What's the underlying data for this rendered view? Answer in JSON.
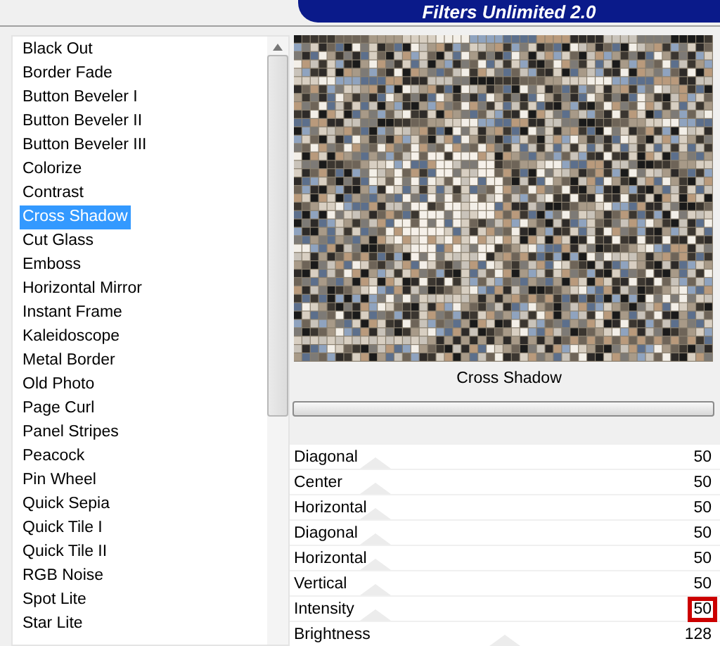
{
  "banner": {
    "title": "Filters Unlimited 2.0"
  },
  "filters": [
    {
      "label": "Black Out",
      "selected": false
    },
    {
      "label": "Border Fade",
      "selected": false
    },
    {
      "label": "Button Beveler I",
      "selected": false
    },
    {
      "label": "Button Beveler II",
      "selected": false
    },
    {
      "label": "Button Beveler III",
      "selected": false
    },
    {
      "label": "Colorize",
      "selected": false
    },
    {
      "label": "Contrast",
      "selected": false
    },
    {
      "label": "Cross Shadow",
      "selected": true
    },
    {
      "label": "Cut Glass",
      "selected": false
    },
    {
      "label": "Emboss",
      "selected": false
    },
    {
      "label": "Horizontal Mirror",
      "selected": false
    },
    {
      "label": "Instant Frame",
      "selected": false
    },
    {
      "label": "Kaleidoscope",
      "selected": false
    },
    {
      "label": "Metal Border",
      "selected": false
    },
    {
      "label": "Old Photo",
      "selected": false
    },
    {
      "label": "Page Curl",
      "selected": false
    },
    {
      "label": "Panel Stripes",
      "selected": false
    },
    {
      "label": "Peacock",
      "selected": false
    },
    {
      "label": "Pin Wheel",
      "selected": false
    },
    {
      "label": "Quick Sepia",
      "selected": false
    },
    {
      "label": "Quick Tile I",
      "selected": false
    },
    {
      "label": "Quick Tile II",
      "selected": false
    },
    {
      "label": "RGB Noise",
      "selected": false
    },
    {
      "label": "Spot Lite",
      "selected": false
    },
    {
      "label": "Star Lite",
      "selected": false
    }
  ],
  "preview": {
    "caption": "Cross Shadow"
  },
  "parameters": [
    {
      "label": "Diagonal",
      "value": "50",
      "level": 0.2,
      "highlighted": false
    },
    {
      "label": "Center",
      "value": "50",
      "level": 0.2,
      "highlighted": false
    },
    {
      "label": "Horizontal",
      "value": "50",
      "level": 0.2,
      "highlighted": false
    },
    {
      "label": "Diagonal",
      "value": "50",
      "level": 0.2,
      "highlighted": false
    },
    {
      "label": "Horizontal",
      "value": "50",
      "level": 0.2,
      "highlighted": false
    },
    {
      "label": "Vertical",
      "value": "50",
      "level": 0.2,
      "highlighted": false
    },
    {
      "label": "Intensity",
      "value": "50",
      "level": 0.2,
      "highlighted": true
    },
    {
      "label": "Brightness",
      "value": "128",
      "level": 0.5,
      "highlighted": false
    }
  ]
}
